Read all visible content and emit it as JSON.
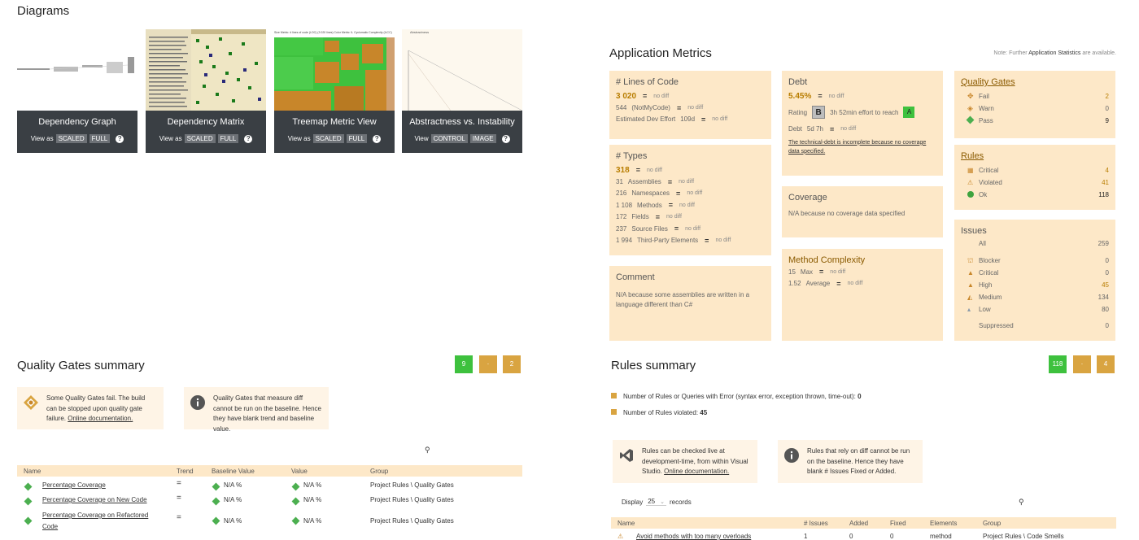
{
  "diagrams": {
    "title": "Diagrams",
    "cards": [
      {
        "label": "Dependency Graph",
        "view_prefix": "View as",
        "btn1": "SCALED",
        "btn2": "FULL"
      },
      {
        "label": "Dependency Matrix",
        "view_prefix": "View as",
        "btn1": "SCALED",
        "btn2": "FULL"
      },
      {
        "label": "Treemap Metric View",
        "view_prefix": "View as",
        "btn1": "SCALED",
        "btn2": "FULL"
      },
      {
        "label": "Abstractness vs. Instability",
        "view_prefix": "View",
        "btn1": "CONTROL",
        "btn2": "IMAGE"
      }
    ],
    "treemap_caption": "Size Metric: # lines of code (LOC) (3 020 lines)   Color Metric: IL Cyclomatic Complexity (ILCC)",
    "abstractness_axis": "Abstractness"
  },
  "app_metrics": {
    "title": "Application Metrics",
    "note_prefix": "Note: Further",
    "note_link": "Application Statistics",
    "note_suffix": "are available.",
    "loc": {
      "title": "# Lines of Code",
      "value": "3 020",
      "nodiff": "no diff",
      "notmycode_val": "544",
      "notmycode_label": "(NotMyCode)",
      "effort_label": "Estimated Dev Effort",
      "effort_val": "109d"
    },
    "types": {
      "title": "# Types",
      "value": "318",
      "nodiff": "no diff",
      "rows": [
        {
          "v": "31",
          "l": "Assemblies"
        },
        {
          "v": "216",
          "l": "Namespaces"
        },
        {
          "v": "1 108",
          "l": "Methods"
        },
        {
          "v": "172",
          "l": "Fields"
        },
        {
          "v": "237",
          "l": "Source Files"
        },
        {
          "v": "1 994",
          "l": "Third-Party Elements"
        }
      ]
    },
    "comment": {
      "title": "Comment",
      "text": "N/A because some assemblies are written in a language different than C#"
    },
    "debt": {
      "title": "Debt",
      "value": "5.45%",
      "nodiff": "no diff",
      "rating_label": "Rating",
      "rating": "B",
      "effort": "3h 52min effort to reach",
      "target": "A",
      "debt_label": "Debt",
      "debt_val": "5d 7h",
      "incomplete": "The technical-debt is incomplete because no coverage data specified."
    },
    "coverage": {
      "title": "Coverage",
      "text": "N/A because no coverage data specified"
    },
    "complexity": {
      "title": "Method Complexity",
      "max_val": "15",
      "max_label": "Max",
      "avg_val": "1.52",
      "avg_label": "Average",
      "nodiff": "no diff"
    },
    "quality_gates": {
      "title": "Quality Gates",
      "rows": [
        {
          "label": "Fail",
          "value": "2"
        },
        {
          "label": "Warn",
          "value": "0"
        },
        {
          "label": "Pass",
          "value": "9"
        }
      ]
    },
    "rules": {
      "title": "Rules",
      "rows": [
        {
          "label": "Critical",
          "value": "4"
        },
        {
          "label": "Violated",
          "value": "41"
        },
        {
          "label": "Ok",
          "value": "118"
        }
      ]
    },
    "issues": {
      "title": "Issues",
      "all_label": "All",
      "all_value": "259",
      "rows": [
        {
          "label": "Blocker",
          "value": "0"
        },
        {
          "label": "Critical",
          "value": "0"
        },
        {
          "label": "High",
          "value": "45"
        },
        {
          "label": "Medium",
          "value": "134"
        },
        {
          "label": "Low",
          "value": "80"
        }
      ],
      "suppressed_label": "Suppressed",
      "suppressed_value": "0"
    }
  },
  "qg_summary": {
    "title": "Quality Gates summary",
    "btns": [
      "9",
      "·",
      "2"
    ],
    "note1": {
      "text": "Some Quality Gates fail. The build can be stopped upon quality gate failure.",
      "link": "Online documentation."
    },
    "note2": {
      "text": "Quality Gates that measure diff cannot be run on the baseline. Hence they have blank trend and baseline value."
    },
    "columns": [
      "Name",
      "Trend",
      "Baseline Value",
      "Value",
      "Group"
    ],
    "rows": [
      {
        "name": "Percentage Coverage",
        "trend": "=",
        "baseline": "N/A %",
        "value": "N/A %",
        "group": "Project Rules \\ Quality Gates"
      },
      {
        "name": "Percentage Coverage on New Code",
        "trend": "=",
        "baseline": "N/A %",
        "value": "N/A %",
        "group": "Project Rules \\ Quality Gates"
      },
      {
        "name": "Percentage Coverage on Refactored Code",
        "trend": "=",
        "baseline": "N/A %",
        "value": "N/A %",
        "group": "Project Rules \\ Quality Gates"
      }
    ]
  },
  "rules_summary": {
    "title": "Rules summary",
    "btns": [
      "118",
      "·",
      "4"
    ],
    "line1_label": "Number of Rules or Queries with Error (syntax error, exception thrown, time-out):",
    "line1_value": "0",
    "line2_label": "Number of Rules violated:",
    "line2_value": "45",
    "note1": {
      "text": "Rules can be checked live at development-time, from within Visual Studio.",
      "link": "Online documentation."
    },
    "note2": {
      "text": "Rules that rely on diff cannot be run on the baseline. Hence they have blank # Issues Fixed or Added."
    },
    "display_label": "Display",
    "display_value": "25",
    "records_label": "records",
    "columns": [
      "Name",
      "# Issues",
      "Added",
      "Fixed",
      "Elements",
      "Group"
    ],
    "rows": [
      {
        "name": "Avoid methods with too many overloads",
        "issues": "1",
        "added": "0",
        "fixed": "0",
        "elements": "method",
        "group": "Project Rules \\ Code Smells"
      }
    ]
  },
  "colors": {
    "panel": "#fde8c8",
    "accent": "#b87d00",
    "green": "#3ec13e",
    "orange": "#d9a441",
    "dark": "#3a3f44"
  }
}
